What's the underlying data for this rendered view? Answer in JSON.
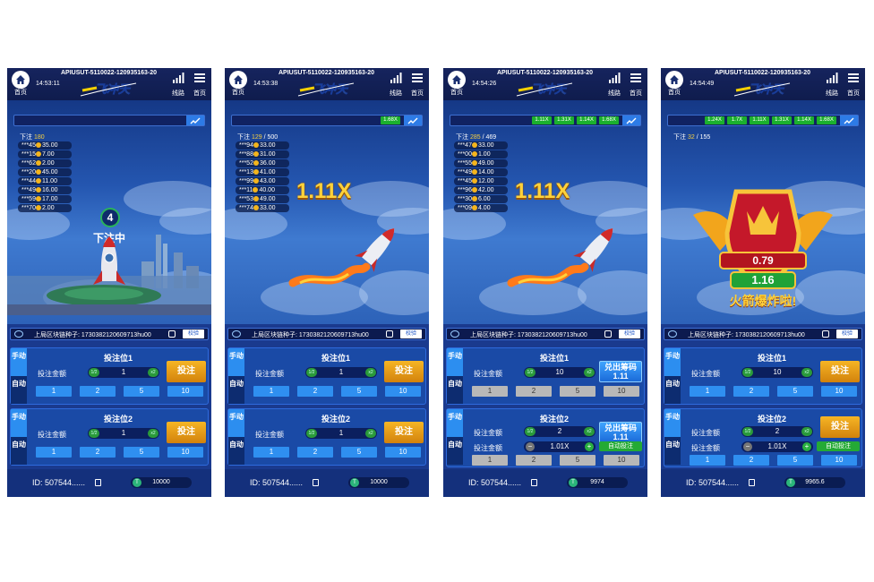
{
  "common": {
    "home_label": "首页",
    "route_label": "线路",
    "menu_label": "首页",
    "seed_label": "上局区块链种子:",
    "verify_label": "校验",
    "bet_slot_1": "投注位1",
    "bet_slot_2": "投注位2",
    "amount_label": "投注金额",
    "half": "1/2",
    "double": "x2",
    "manual_tab": "手动",
    "auto_tab": "自动",
    "bet_button": "投注",
    "cashout_label": "兑出筹码",
    "auto_bet_label": "自动投注",
    "user_id": "ID: 507544......",
    "chip_values": [
      "1",
      "2",
      "5",
      "10"
    ],
    "betting_label": "下注"
  },
  "screens": [
    {
      "api_id": "APIUSUT-5110022-120935163-20",
      "time": "14:53:11",
      "seed": "1730382120609713hu00",
      "bet_count": "180",
      "bets": [
        "***45",
        "35.00",
        "***15",
        "7.00",
        "***62",
        "2.00",
        "***20",
        "45.00",
        "***44",
        "11.00",
        "***49",
        "16.00",
        "***59",
        "17.00",
        "***70",
        "2.00"
      ],
      "countdown": "4",
      "status": "下注中",
      "slot1_value": "1",
      "slot2_value": "1",
      "balance": "10000"
    },
    {
      "api_id": "APIUSUT-5110022-120935163-20",
      "time": "14:53:38",
      "seed": "1730382120609713hu00",
      "bet_count": "129",
      "bet_total": "/ 500",
      "multipliers": [
        "1.68X"
      ],
      "bets": [
        "***94",
        "33.00",
        "***88",
        "31.00",
        "***52",
        "36.00",
        "***13",
        "41.00",
        "***99",
        "43.00",
        "***11",
        "40.00",
        "***53",
        "49.00",
        "***74",
        "33.00"
      ],
      "multiplier": "1.11X",
      "slot1_value": "1",
      "slot2_value": "1",
      "balance": "10000"
    },
    {
      "api_id": "APIUSUT-5110022-120935163-20",
      "time": "14:54:26",
      "seed": "1730382120609713hu00",
      "bet_count": "285",
      "bet_total": "/ 469",
      "multipliers": [
        "1.11X",
        "1.31X",
        "1.14X",
        "1.68X"
      ],
      "bets": [
        "***47",
        "33.00",
        "***00",
        "1.00",
        "***55",
        "49.00",
        "***49",
        "14.00",
        "***45",
        "12.00",
        "***96",
        "42.00",
        "***30",
        "6.00",
        "***09",
        "4.00"
      ],
      "multiplier": "1.11X",
      "slot1_value": "10",
      "cash1": "1.11",
      "slot2_value": "2",
      "auto_value": "1.01X",
      "cash2": "1.11",
      "balance": "9974"
    },
    {
      "api_id": "APIUSUT-5110022-120935163-20",
      "time": "14:54:49",
      "seed": "1730382120609713hu00",
      "bet_count": "32",
      "bet_total": "/ 155",
      "multipliers": [
        "1.24X",
        "1.7X",
        "1.11X",
        "1.31X",
        "1.14X",
        "1.68X"
      ],
      "badge_value": "0.79",
      "badge_mult": "1.16",
      "badge_text": "火箭爆炸啦!",
      "slot1_value": "10",
      "slot2_value": "2",
      "auto_value": "1.01X",
      "balance": "9965.6"
    }
  ]
}
